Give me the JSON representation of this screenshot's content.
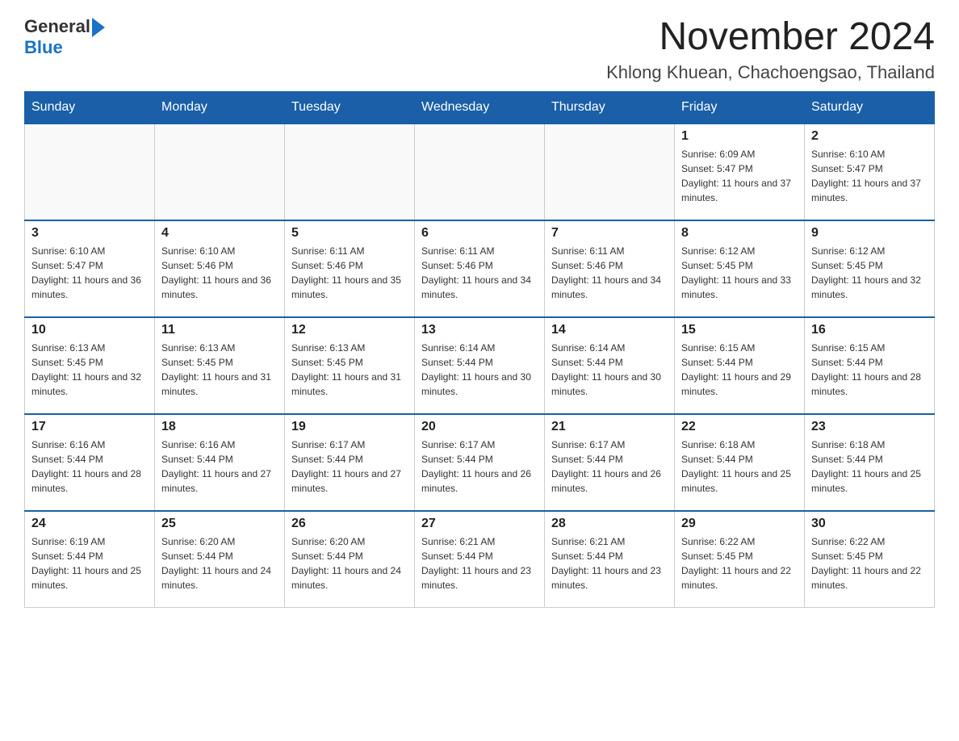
{
  "logo": {
    "general": "General",
    "blue": "Blue"
  },
  "title": "November 2024",
  "subtitle": "Khlong Khuean, Chachoengsao, Thailand",
  "weekdays": [
    "Sunday",
    "Monday",
    "Tuesday",
    "Wednesday",
    "Thursday",
    "Friday",
    "Saturday"
  ],
  "weeks": [
    [
      {
        "day": "",
        "info": ""
      },
      {
        "day": "",
        "info": ""
      },
      {
        "day": "",
        "info": ""
      },
      {
        "day": "",
        "info": ""
      },
      {
        "day": "",
        "info": ""
      },
      {
        "day": "1",
        "info": "Sunrise: 6:09 AM\nSunset: 5:47 PM\nDaylight: 11 hours and 37 minutes."
      },
      {
        "day": "2",
        "info": "Sunrise: 6:10 AM\nSunset: 5:47 PM\nDaylight: 11 hours and 37 minutes."
      }
    ],
    [
      {
        "day": "3",
        "info": "Sunrise: 6:10 AM\nSunset: 5:47 PM\nDaylight: 11 hours and 36 minutes."
      },
      {
        "day": "4",
        "info": "Sunrise: 6:10 AM\nSunset: 5:46 PM\nDaylight: 11 hours and 36 minutes."
      },
      {
        "day": "5",
        "info": "Sunrise: 6:11 AM\nSunset: 5:46 PM\nDaylight: 11 hours and 35 minutes."
      },
      {
        "day": "6",
        "info": "Sunrise: 6:11 AM\nSunset: 5:46 PM\nDaylight: 11 hours and 34 minutes."
      },
      {
        "day": "7",
        "info": "Sunrise: 6:11 AM\nSunset: 5:46 PM\nDaylight: 11 hours and 34 minutes."
      },
      {
        "day": "8",
        "info": "Sunrise: 6:12 AM\nSunset: 5:45 PM\nDaylight: 11 hours and 33 minutes."
      },
      {
        "day": "9",
        "info": "Sunrise: 6:12 AM\nSunset: 5:45 PM\nDaylight: 11 hours and 32 minutes."
      }
    ],
    [
      {
        "day": "10",
        "info": "Sunrise: 6:13 AM\nSunset: 5:45 PM\nDaylight: 11 hours and 32 minutes."
      },
      {
        "day": "11",
        "info": "Sunrise: 6:13 AM\nSunset: 5:45 PM\nDaylight: 11 hours and 31 minutes."
      },
      {
        "day": "12",
        "info": "Sunrise: 6:13 AM\nSunset: 5:45 PM\nDaylight: 11 hours and 31 minutes."
      },
      {
        "day": "13",
        "info": "Sunrise: 6:14 AM\nSunset: 5:44 PM\nDaylight: 11 hours and 30 minutes."
      },
      {
        "day": "14",
        "info": "Sunrise: 6:14 AM\nSunset: 5:44 PM\nDaylight: 11 hours and 30 minutes."
      },
      {
        "day": "15",
        "info": "Sunrise: 6:15 AM\nSunset: 5:44 PM\nDaylight: 11 hours and 29 minutes."
      },
      {
        "day": "16",
        "info": "Sunrise: 6:15 AM\nSunset: 5:44 PM\nDaylight: 11 hours and 28 minutes."
      }
    ],
    [
      {
        "day": "17",
        "info": "Sunrise: 6:16 AM\nSunset: 5:44 PM\nDaylight: 11 hours and 28 minutes."
      },
      {
        "day": "18",
        "info": "Sunrise: 6:16 AM\nSunset: 5:44 PM\nDaylight: 11 hours and 27 minutes."
      },
      {
        "day": "19",
        "info": "Sunrise: 6:17 AM\nSunset: 5:44 PM\nDaylight: 11 hours and 27 minutes."
      },
      {
        "day": "20",
        "info": "Sunrise: 6:17 AM\nSunset: 5:44 PM\nDaylight: 11 hours and 26 minutes."
      },
      {
        "day": "21",
        "info": "Sunrise: 6:17 AM\nSunset: 5:44 PM\nDaylight: 11 hours and 26 minutes."
      },
      {
        "day": "22",
        "info": "Sunrise: 6:18 AM\nSunset: 5:44 PM\nDaylight: 11 hours and 25 minutes."
      },
      {
        "day": "23",
        "info": "Sunrise: 6:18 AM\nSunset: 5:44 PM\nDaylight: 11 hours and 25 minutes."
      }
    ],
    [
      {
        "day": "24",
        "info": "Sunrise: 6:19 AM\nSunset: 5:44 PM\nDaylight: 11 hours and 25 minutes."
      },
      {
        "day": "25",
        "info": "Sunrise: 6:20 AM\nSunset: 5:44 PM\nDaylight: 11 hours and 24 minutes."
      },
      {
        "day": "26",
        "info": "Sunrise: 6:20 AM\nSunset: 5:44 PM\nDaylight: 11 hours and 24 minutes."
      },
      {
        "day": "27",
        "info": "Sunrise: 6:21 AM\nSunset: 5:44 PM\nDaylight: 11 hours and 23 minutes."
      },
      {
        "day": "28",
        "info": "Sunrise: 6:21 AM\nSunset: 5:44 PM\nDaylight: 11 hours and 23 minutes."
      },
      {
        "day": "29",
        "info": "Sunrise: 6:22 AM\nSunset: 5:45 PM\nDaylight: 11 hours and 22 minutes."
      },
      {
        "day": "30",
        "info": "Sunrise: 6:22 AM\nSunset: 5:45 PM\nDaylight: 11 hours and 22 minutes."
      }
    ]
  ]
}
